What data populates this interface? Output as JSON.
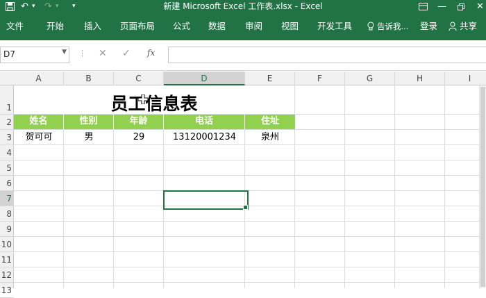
{
  "window": {
    "title": "新建 Microsoft Excel 工作表.xlsx - Excel"
  },
  "quick_access": {
    "save_icon": "save-icon",
    "undo_icon": "undo-icon",
    "redo_icon": "redo-icon",
    "customize_icon": "customize-icon"
  },
  "window_controls": {
    "ribbon_display_icon": "ribbon-display-icon",
    "minimize_icon": "minimize-icon",
    "restore_icon": "restore-icon",
    "close_icon": "close-icon"
  },
  "ribbon": {
    "tabs": [
      "文件",
      "开始",
      "插入",
      "页面布局",
      "公式",
      "数据",
      "审阅",
      "视图",
      "开发工具"
    ],
    "tell_me": "告诉我...",
    "login": "登录",
    "share": "共享"
  },
  "formula_bar": {
    "name_box": "D7",
    "cancel_glyph": "✕",
    "enter_glyph": "✓",
    "fx_label": "fx",
    "formula": ""
  },
  "columns": [
    "A",
    "B",
    "C",
    "D",
    "E",
    "F",
    "G",
    "H",
    "I"
  ],
  "rows": [
    "1",
    "2",
    "3",
    "4",
    "5",
    "6",
    "7",
    "8",
    "9",
    "10",
    "11",
    "12",
    "13"
  ],
  "selected_cell": "D7",
  "sheet": {
    "title": "员工信息表",
    "headers": [
      "姓名",
      "性别",
      "年龄",
      "电话",
      "住址"
    ],
    "records": [
      [
        "贺可可",
        "男",
        "29",
        "13120001234",
        "泉州"
      ]
    ]
  },
  "colors": {
    "excel_green": "#217346",
    "header_fill": "#92d050"
  }
}
